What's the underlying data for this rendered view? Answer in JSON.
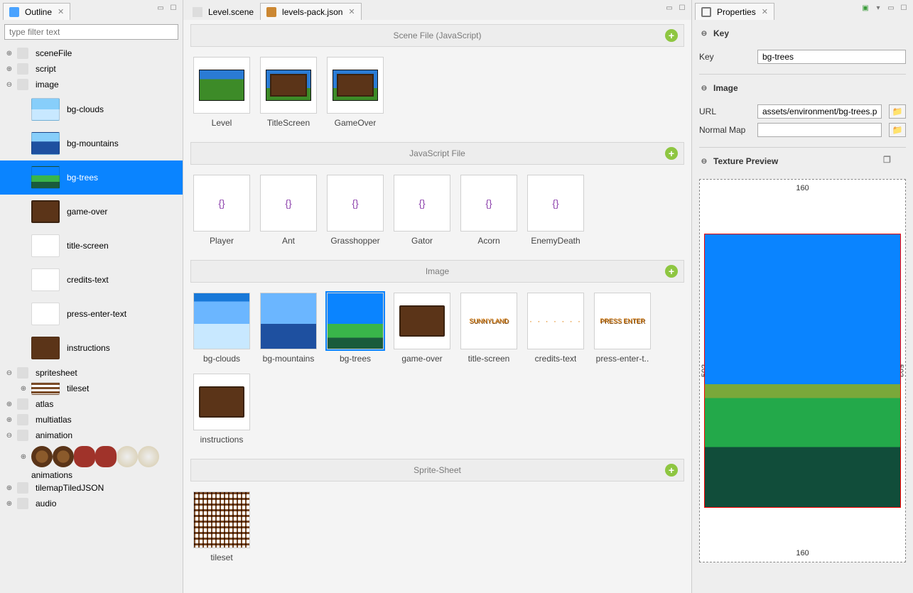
{
  "outline": {
    "title": "Outline",
    "filter_placeholder": "type filter text",
    "tree": {
      "sceneFile": "sceneFile",
      "script": "script",
      "image": "image",
      "images": [
        {
          "key": "bg-clouds",
          "label": "bg-clouds"
        },
        {
          "key": "bg-mountains",
          "label": "bg-mountains"
        },
        {
          "key": "bg-trees",
          "label": "bg-trees",
          "selected": true
        },
        {
          "key": "game-over",
          "label": "game-over"
        },
        {
          "key": "title-screen",
          "label": "title-screen"
        },
        {
          "key": "credits-text",
          "label": "credits-text"
        },
        {
          "key": "press-enter-text",
          "label": "press-enter-text"
        },
        {
          "key": "instructions",
          "label": "instructions"
        }
      ],
      "spritesheet": "spritesheet",
      "tileset": "tileset",
      "atlas": "atlas",
      "multiatlas": "multiatlas",
      "animation": "animation",
      "animations": "animations",
      "tilemap": "tilemapTiledJSON",
      "audio": "audio"
    }
  },
  "editor": {
    "tabs": [
      {
        "label": "Level.scene",
        "active": false
      },
      {
        "label": "levels-pack.json",
        "active": true
      }
    ],
    "sections": {
      "scene": {
        "title": "Scene File (JavaScript)",
        "items": [
          "Level",
          "TitleScreen",
          "GameOver"
        ]
      },
      "js": {
        "title": "JavaScript File",
        "items": [
          "Player",
          "Ant",
          "Grasshopper",
          "Gator",
          "Acorn",
          "EnemyDeath"
        ]
      },
      "image": {
        "title": "Image",
        "items": [
          "bg-clouds",
          "bg-mountains",
          "bg-trees",
          "game-over",
          "title-screen",
          "credits-text",
          "press-enter-t..",
          "instructions"
        ],
        "selected": "bg-trees"
      },
      "spritesheet": {
        "title": "Sprite-Sheet",
        "items": [
          "tileset"
        ]
      }
    }
  },
  "properties": {
    "title": "Properties",
    "key_section": "Key",
    "key_label": "Key",
    "key_value": "bg-trees",
    "image_section": "Image",
    "url_label": "URL",
    "url_value": "assets/environment/bg-trees.pr",
    "normal_label": "Normal Map",
    "normal_value": "",
    "preview_section": "Texture Preview",
    "preview_w": "160",
    "preview_h": "160",
    "preview_side": "502"
  }
}
